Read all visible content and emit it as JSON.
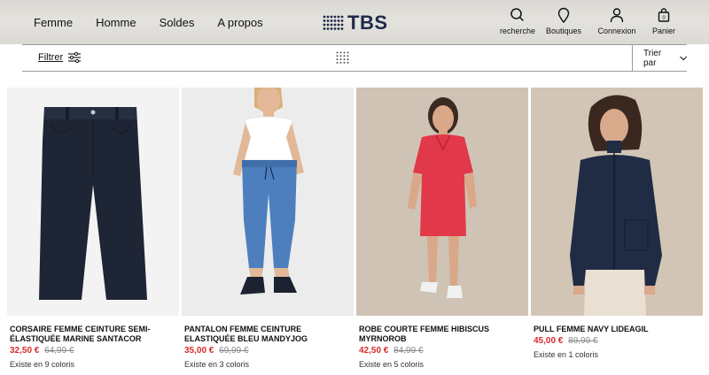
{
  "header": {
    "nav": [
      "Femme",
      "Homme",
      "Soldes",
      "A propos"
    ],
    "logo_text": "TBS",
    "icons": [
      {
        "label": "recherche",
        "icon": "search-icon"
      },
      {
        "label": "Boutiques",
        "icon": "location-pin-icon"
      },
      {
        "label": "Connexion",
        "icon": "user-icon"
      },
      {
        "label": "Panier",
        "icon": "shopping-bag-icon"
      }
    ]
  },
  "toolbar": {
    "filter_label": "Filtrer",
    "sort_label": "Trier par"
  },
  "products": [
    {
      "name": "CORSAIRE FEMME CEINTURE SEMI-ÉLASTIQUÉE MARINE SANTACOR",
      "price": "32,50 €",
      "old_price": "64,99 €",
      "colors": "Existe en 9 coloris"
    },
    {
      "name": "PANTALON FEMME CEINTURE ELASTIQUÉE BLEU MANDYJOG",
      "price": "35,00 €",
      "old_price": "69,99 €",
      "colors": "Existe en 3 coloris"
    },
    {
      "name": "ROBE COURTE FEMME HIBISCUS MYRNOROB",
      "price": "42,50 €",
      "old_price": "84,99 €",
      "colors": "Existe en 5 coloris"
    },
    {
      "name": "PULL FEMME NAVY LIDEAGIL",
      "price": "45,00 €",
      "old_price": "89,99 €",
      "colors": "Existe en 1 coloris"
    }
  ],
  "colors": {
    "price_sale": "#d52b2b",
    "logo": "#1f2a4a"
  }
}
